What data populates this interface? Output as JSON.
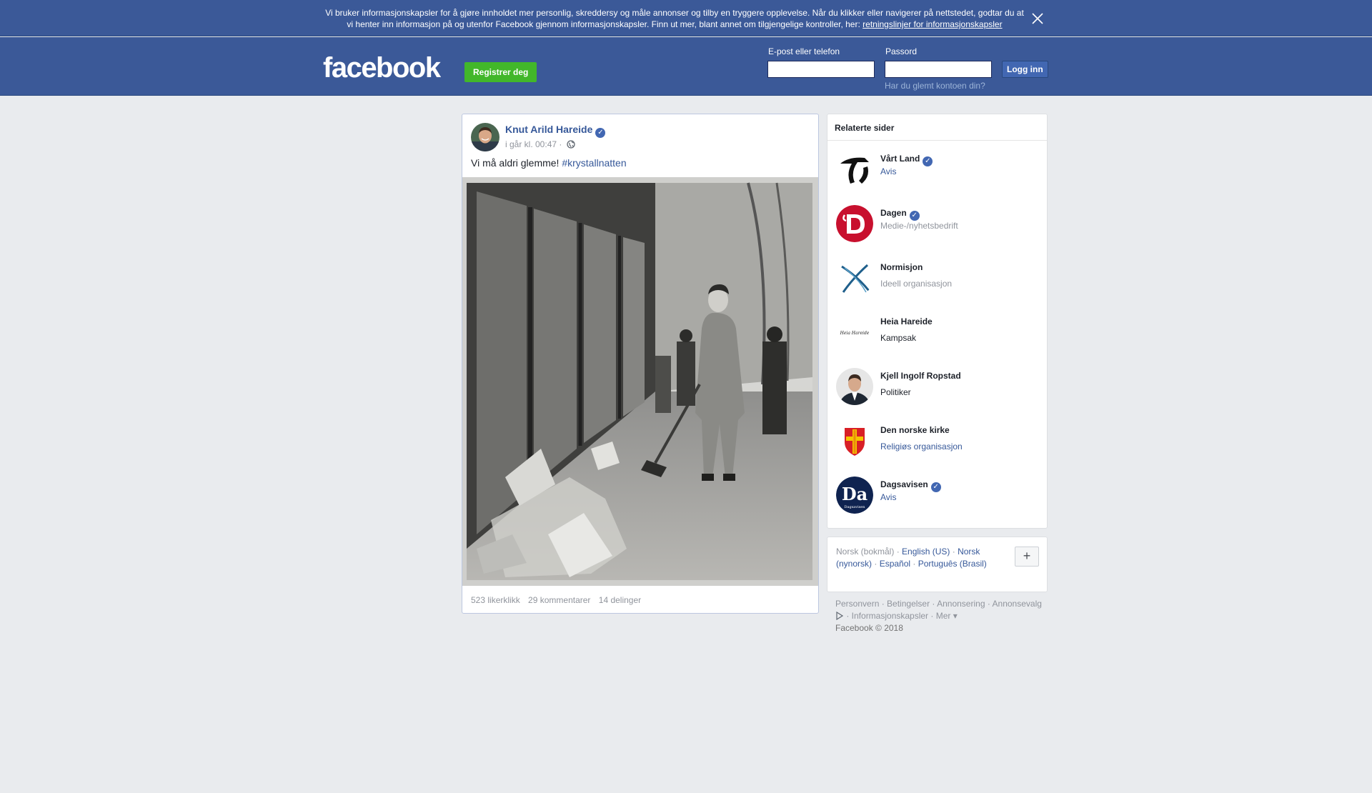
{
  "cookie_banner": {
    "text": "Vi bruker informasjonskapsler for å gjøre innholdet mer personlig, skreddersy og måle annonser og tilby en tryggere opplevelse. Når du klikker eller navigerer på nettstedet, godtar du at vi henter inn informasjon på og utenfor Facebook gjennom informasjonskapsler. Finn ut mer, blant annet om tilgjengelige kontroller, her: ",
    "policy_link": "retningslinjer for informasjonskapsler",
    "close_icon": "close-icon"
  },
  "header": {
    "logo": "facebook",
    "register_label": "Registrer deg",
    "email_label": "E-post eller telefon",
    "password_label": "Passord",
    "login_label": "Logg inn",
    "forgot_label": "Har du glemt kontoen din?"
  },
  "post": {
    "author": "Knut Arild Hareide",
    "time": "i går kl. 00:47 ·",
    "text": "Vi må aldri glemme!",
    "hashtag": "#krystallnatten",
    "likes": "523 likerklikk",
    "comments": "29 kommentarer",
    "shares": "14 delinger"
  },
  "related": {
    "title": "Relaterte sider",
    "items": [
      {
        "name": "Vårt Land",
        "category": "Avis"
      },
      {
        "name": "Dagen",
        "category": "Medie-/nyhetsbedrift"
      },
      {
        "name": "Normisjon",
        "category": "Ideell organisasjon"
      },
      {
        "name": "Heia Hareide",
        "category": "Kampsak",
        "logo_text": "Heia Hareide"
      },
      {
        "name": "Kjell Ingolf Ropstad",
        "category": "Politiker"
      },
      {
        "name": "Den norske kirke",
        "category": "Religiøs organisasjon"
      },
      {
        "name": "Dagsavisen",
        "category": "Avis",
        "logo_text": "Da",
        "logo_sub": "Dagsavisen"
      }
    ]
  },
  "languages": {
    "current": "Norsk (bokmål)",
    "en": "English (US)",
    "nn": "Norsk (nynorsk)",
    "es": "Español",
    "pt": "Português (Brasil)",
    "add": "+"
  },
  "footer": {
    "privacy": "Personvern",
    "terms": "Betingelser",
    "ads": "Annonsering",
    "adchoices": "Annonsevalg",
    "cookies": "Informasjonskapsler",
    "more": "Mer",
    "copyright": "Facebook © 2018"
  }
}
